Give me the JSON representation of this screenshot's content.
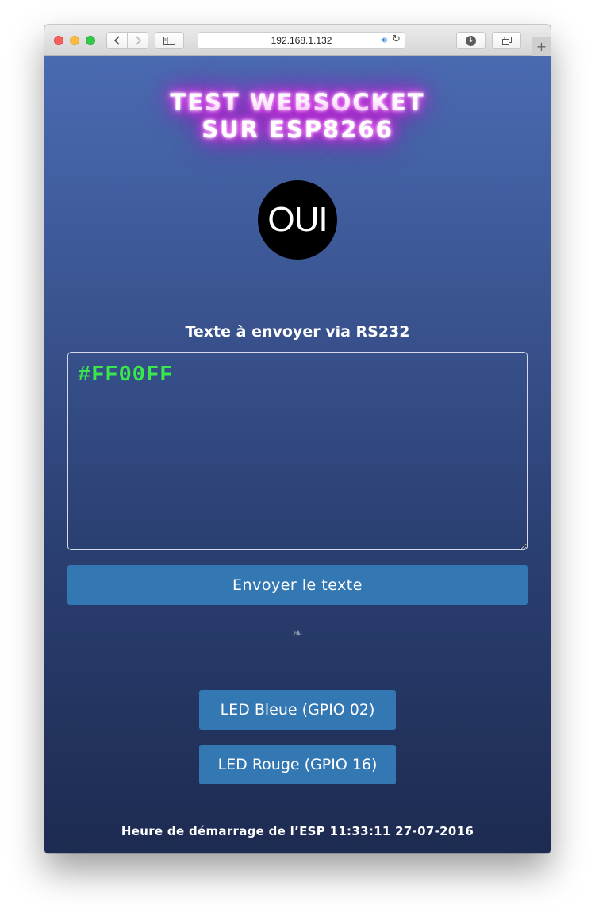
{
  "browser": {
    "url": "192.168.1.132",
    "icons": {
      "back": "chevron-left-icon",
      "forward": "chevron-right-icon",
      "sidebar": "sidebar-icon",
      "audio": "speaker-icon",
      "reload": "reload-icon",
      "download": "download-icon",
      "tabs": "tabs-overview-icon",
      "new_tab": "plus-icon"
    }
  },
  "page": {
    "title_line1": "TEST WEBSOCKET",
    "title_line2": "SUR ESP8266",
    "status_label": "OUI",
    "rs232_label": "Texte à envoyer via RS232",
    "textarea_value": "#FF00FF",
    "send_button": "Envoyer le texte",
    "separator": "❧",
    "led_blue_button": "LED Bleue (GPIO 02)",
    "led_red_button": "LED Rouge (GPIO 16)",
    "footer": "Heure de démarrage de l’ESP 11:33:11 27-07-2016"
  },
  "colors": {
    "background_top": "#4a6ab1",
    "background_bottom": "#1d2b51",
    "button": "#3377b3",
    "text_green": "#39e84a",
    "title_glow": "#ff33ff"
  }
}
